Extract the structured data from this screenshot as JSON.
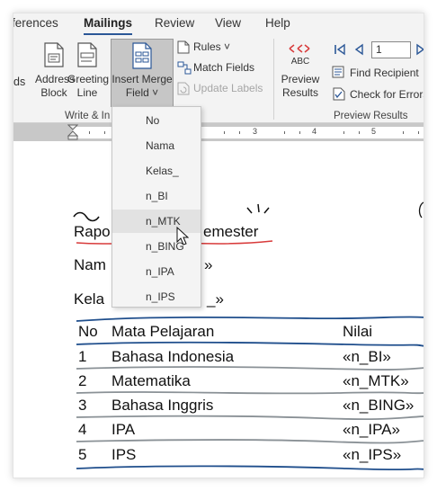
{
  "tabs": [
    "ferences",
    "Mailings",
    "Review",
    "View",
    "Help"
  ],
  "ribbon": {
    "address_block": [
      "Address",
      "Block"
    ],
    "greeting_line": [
      "Greeting",
      "Line"
    ],
    "insert_merge_field": [
      "Insert Merge",
      "Field ˅"
    ],
    "rules": "Rules ˅",
    "match_fields": "Match Fields",
    "update_labels": "Update Labels",
    "preview_results": [
      "Preview",
      "Results"
    ],
    "abc_label": "ABC",
    "record_value": "1",
    "find_recipient": "Find Recipient",
    "check_errors": "Check for Errors",
    "group_write": "Write & In",
    "group_preview": "Preview Results",
    "left_fragment": "ds"
  },
  "ruler_numbers": [
    "3",
    "4",
    "5"
  ],
  "dropdown": {
    "items": [
      "No",
      "Nama",
      "Kelas_",
      "n_BI",
      "n_MTK",
      "n_BING",
      "n_IPA",
      "n_IPS"
    ],
    "hovered_index": 4
  },
  "document": {
    "title_left": "Rapo",
    "title_right": "emester",
    "nama_left": "Nam",
    "nama_right": "»",
    "kelas_left": "Kela",
    "kelas_right": "_»",
    "table": {
      "headers": [
        "No",
        "Mata Pelajaran",
        "Nilai"
      ],
      "rows": [
        [
          "1",
          "Bahasa Indonesia",
          "«n_BI»"
        ],
        [
          "2",
          "Matematika",
          "«n_MTK»"
        ],
        [
          "3",
          "Bahasa Inggris",
          "«n_BING»"
        ],
        [
          "4",
          "IPA",
          "«n_IPA»"
        ],
        [
          "5",
          "IPS",
          "«n_IPS»"
        ]
      ]
    }
  },
  "colors": {
    "accent": "#2b5797",
    "annotation_blue": "#1f4e8c",
    "annotation_red": "#d83b3b",
    "annotation_gray": "#8a9196"
  }
}
